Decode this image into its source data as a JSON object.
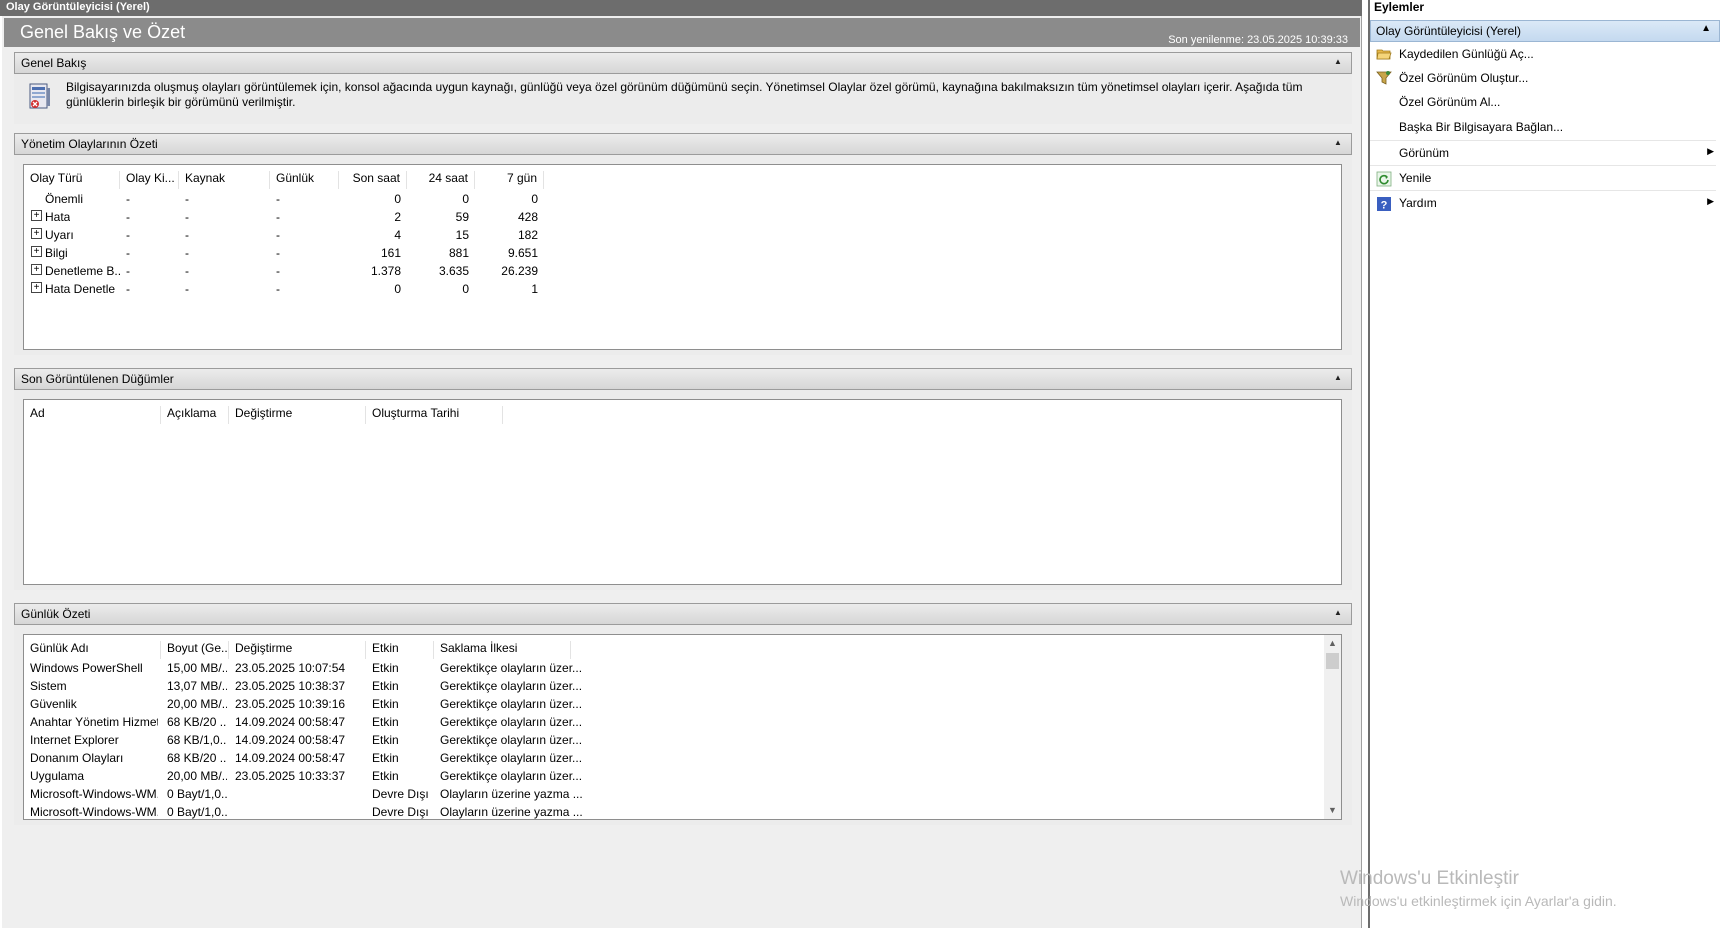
{
  "main_window": {
    "title": "Olay Görüntüleyicisi (Yerel)",
    "page_title": "Genel Bakış ve Özet",
    "last_refresh": "Son yenilenme: 23.05.2025 10:39:33"
  },
  "overview": {
    "header": "Genel Bakış",
    "text": "Bilgisayarınızda oluşmuş olayları görüntülemek için, konsol ağacında uygun kaynağı, günlüğü veya özel görünüm düğümünü seçin. Yönetimsel Olaylar özel görümü, kaynağına bakılmaksızın tüm yönetimsel olayları içerir. Aşağıda tüm günlüklerin birleşik bir görümünü verilmiştir."
  },
  "admin_summary": {
    "header": "Yönetim Olaylarının Özeti",
    "columns": [
      "Olay Türü",
      "Olay Ki...",
      "Kaynak",
      "Günlük",
      "Son saat",
      "24 saat",
      "7 gün"
    ],
    "rows": [
      {
        "type": "Önemli",
        "id": "-",
        "source": "-",
        "log": "-",
        "hour": "0",
        "day": "0",
        "week": "0",
        "expandable": false
      },
      {
        "type": "Hata",
        "id": "-",
        "source": "-",
        "log": "-",
        "hour": "2",
        "day": "59",
        "week": "428",
        "expandable": true
      },
      {
        "type": "Uyarı",
        "id": "-",
        "source": "-",
        "log": "-",
        "hour": "4",
        "day": "15",
        "week": "182",
        "expandable": true
      },
      {
        "type": "Bilgi",
        "id": "-",
        "source": "-",
        "log": "-",
        "hour": "161",
        "day": "881",
        "week": "9.651",
        "expandable": true
      },
      {
        "type": "Denetleme B...",
        "id": "-",
        "source": "-",
        "log": "-",
        "hour": "1.378",
        "day": "3.635",
        "week": "26.239",
        "expandable": true
      },
      {
        "type": "Hata Denetle",
        "id": "-",
        "source": "-",
        "log": "-",
        "hour": "0",
        "day": "0",
        "week": "1",
        "expandable": true
      }
    ]
  },
  "recent_nodes": {
    "header": "Son Görüntülenen Düğümler",
    "columns": [
      "Ad",
      "Açıklama",
      "Değiştirme",
      "Oluşturma Tarihi"
    ]
  },
  "log_summary": {
    "header": "Günlük Özeti",
    "columns": [
      "Günlük Adı",
      "Boyut (Ge...",
      "Değiştirme",
      "Etkin",
      "Saklama İlkesi"
    ],
    "rows": [
      {
        "name": "Windows PowerShell",
        "size": "15,00 MB/...",
        "modified": "23.05.2025 10:07:54",
        "enabled": "Etkin",
        "policy": "Gerektikçe olayların üzer..."
      },
      {
        "name": "Sistem",
        "size": "13,07 MB/...",
        "modified": "23.05.2025 10:38:37",
        "enabled": "Etkin",
        "policy": "Gerektikçe olayların üzer..."
      },
      {
        "name": "Güvenlik",
        "size": "20,00 MB/...",
        "modified": "23.05.2025 10:39:16",
        "enabled": "Etkin",
        "policy": "Gerektikçe olayların üzer..."
      },
      {
        "name": "Anahtar Yönetim Hizmeti",
        "size": "68 KB/20 ...",
        "modified": "14.09.2024 00:58:47",
        "enabled": "Etkin",
        "policy": "Gerektikçe olayların üzer..."
      },
      {
        "name": "Internet Explorer",
        "size": "68 KB/1,0...",
        "modified": "14.09.2024 00:58:47",
        "enabled": "Etkin",
        "policy": "Gerektikçe olayların üzer..."
      },
      {
        "name": "Donanım Olayları",
        "size": "68 KB/20 ...",
        "modified": "14.09.2024 00:58:47",
        "enabled": "Etkin",
        "policy": "Gerektikçe olayların üzer..."
      },
      {
        "name": "Uygulama",
        "size": "20,00 MB/...",
        "modified": "23.05.2025 10:33:37",
        "enabled": "Etkin",
        "policy": "Gerektikçe olayların üzer..."
      },
      {
        "name": "Microsoft-Windows-WM...",
        "size": "0 Bayt/1,0...",
        "modified": "",
        "enabled": "Devre Dışı",
        "policy": "Olayların üzerine yazma ..."
      },
      {
        "name": "Microsoft-Windows-WM...",
        "size": "0 Bayt/1,0...",
        "modified": "",
        "enabled": "Devre Dışı",
        "policy": "Olayların üzerine yazma ..."
      }
    ]
  },
  "actions_pane": {
    "title": "Eylemler",
    "group": "Olay Görüntüleyicisi (Yerel)",
    "items": [
      {
        "label": "Kaydedilen Günlüğü Aç...",
        "icon": "folder-open-icon"
      },
      {
        "label": "Özel Görünüm Oluştur...",
        "icon": "filter-icon"
      },
      {
        "label": "Özel Görünüm Al...",
        "icon": ""
      },
      {
        "label": "Başka Bir Bilgisayara Bağlan...",
        "icon": ""
      },
      {
        "label": "Görünüm",
        "icon": "",
        "submenu": true
      },
      {
        "label": "Yenile",
        "icon": "refresh-icon"
      },
      {
        "label": "Yardım",
        "icon": "help-icon",
        "submenu": true
      }
    ]
  },
  "watermark": {
    "title": "Windows'u Etkinleştir",
    "subtitle": "Windows'u etkinleştirmek için Ayarlar'a gidin."
  }
}
